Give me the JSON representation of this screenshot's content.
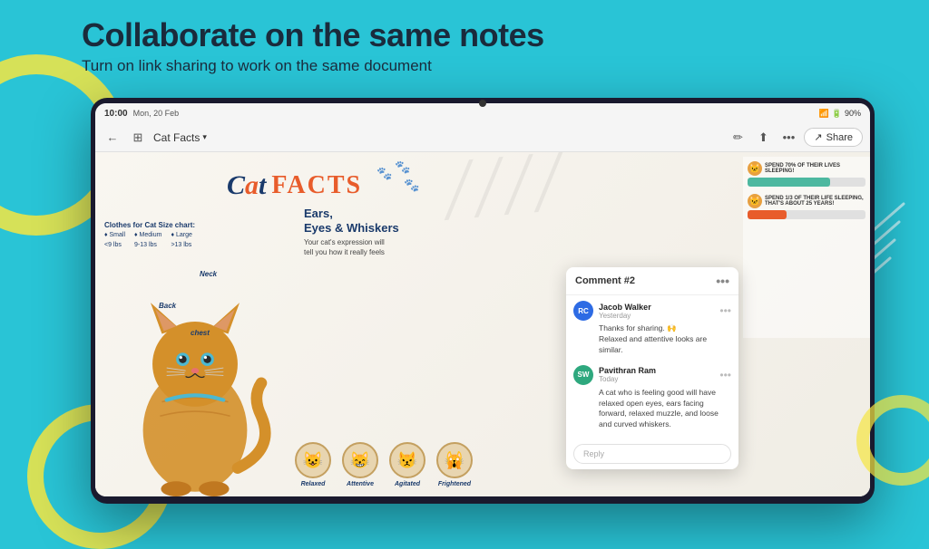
{
  "page": {
    "bg_color": "#29c4d6"
  },
  "header": {
    "main_title": "Collaborate on the same notes",
    "sub_title": "Turn on link sharing to work on the same document"
  },
  "status_bar": {
    "time": "10:00",
    "date": "Mon, 20 Feb",
    "battery": "90%",
    "icons": "🔕 📶"
  },
  "toolbar": {
    "back_icon": "←",
    "grid_icon": "⊞",
    "title": "Cat Facts",
    "title_arrow": "∨",
    "pencil_icon": "✏",
    "export_icon": "⬆",
    "more_icon": "•••",
    "share_icon": "↗",
    "share_label": "Share"
  },
  "note": {
    "title": "Cat Facts",
    "cat_word": "Cat",
    "facts_word": "FACTS",
    "size_chart_title": "Clothes for Cat Size chart:",
    "size_chart_items": [
      "♦ Small   <9 lbs",
      "♦ Medium  9-13 lbs",
      "♦ Large   >13 lbs"
    ],
    "ears_title": "Ears,\nEyes & Whiskers",
    "ears_description": "Your cat's expression will\ntell you how it really feels",
    "cat_faces": [
      {
        "label": "Relaxed",
        "emoji": "😺"
      },
      {
        "label": "Attentive",
        "emoji": "😸"
      },
      {
        "label": "Agitated",
        "emoji": "😾"
      },
      {
        "label": "Frightened",
        "emoji": "🙀"
      }
    ],
    "body_labels": [
      "Neck",
      "Back",
      "Chest"
    ],
    "sleep_bars": [
      {
        "icon": "🐱",
        "text": "SPEND 70% OF THEIR LIVES SLEEPING!",
        "fill_pct": 70,
        "color": "teal"
      },
      {
        "icon": "🐱",
        "text": "SPEND 1/3 OF THEIR LIFE SLEEPING,\nTHAT'S ABOUT 25 YEARS!",
        "fill_pct": 33,
        "color": "orange"
      }
    ]
  },
  "comment_panel": {
    "title": "Comment #2",
    "more_dots": "•••",
    "comments": [
      {
        "author": "Jacob Walker",
        "initials": "RC",
        "avatar_color": "avatar-blue",
        "time": "Yesterday",
        "text": "Thanks for sharing. 🙌\nRelaxed and attentive looks are similar.",
        "more_dots": "•••"
      },
      {
        "author": "Pavithran Ram",
        "initials": "SW",
        "avatar_color": "avatar-green",
        "time": "Today",
        "text": "A cat who is feeling good will have relaxed open eyes, ears facing forward, relaxed muzzle, and loose and curved whiskers.",
        "more_dots": "•••"
      }
    ],
    "reply_placeholder": "Reply"
  }
}
